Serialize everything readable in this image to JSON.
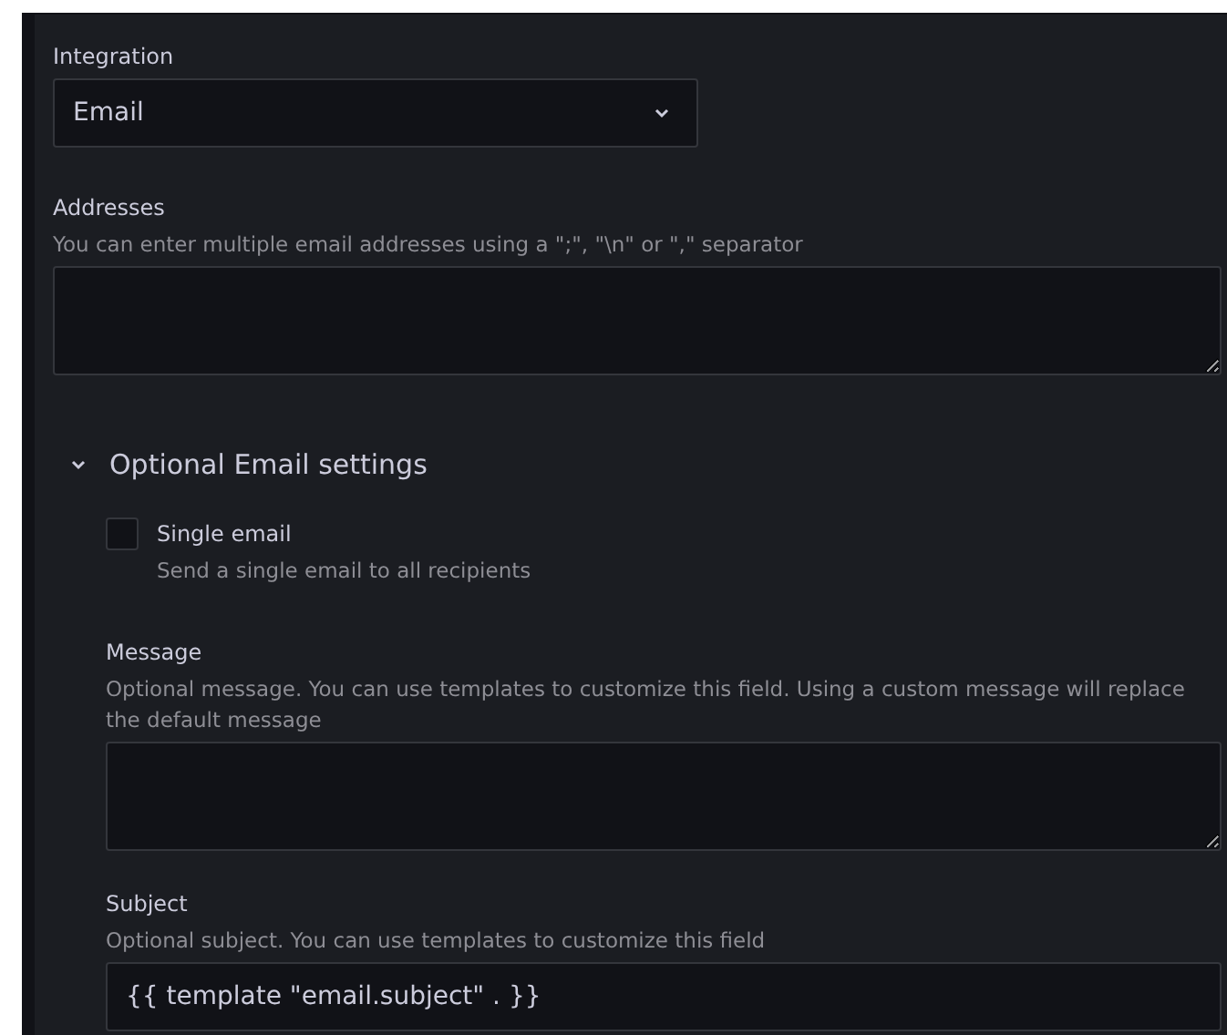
{
  "integration": {
    "label": "Integration",
    "value": "Email"
  },
  "addresses": {
    "label": "Addresses",
    "description": "You can enter multiple email addresses using a \";\", \"\\n\" or \",\" separator"
  },
  "optional_section": {
    "title": "Optional Email settings",
    "expanded": true,
    "single_email": {
      "label": "Single email",
      "description": "Send a single email to all recipients",
      "checked": false
    },
    "message": {
      "label": "Message",
      "description": "Optional message. You can use templates to customize this field. Using a custom message will replace the default message"
    },
    "subject": {
      "label": "Subject",
      "description": "Optional subject. You can use templates to customize this field",
      "value": "{{ template \"email.subject\" . }}"
    }
  }
}
